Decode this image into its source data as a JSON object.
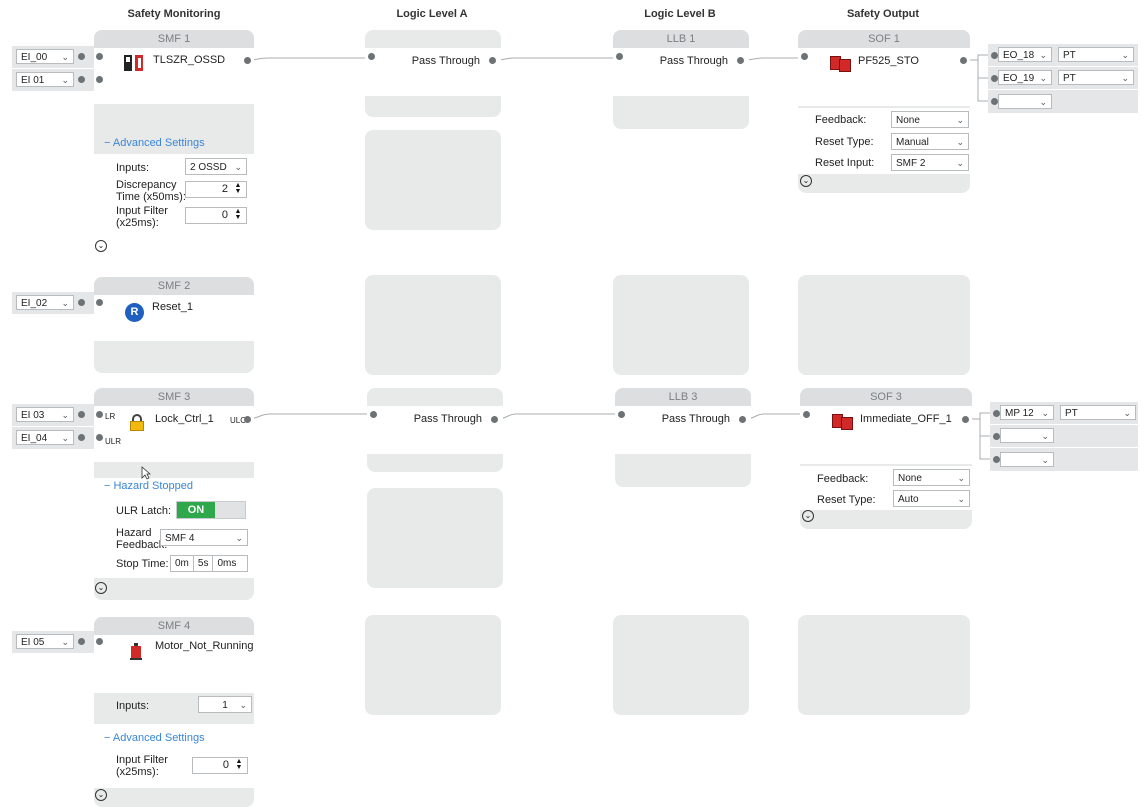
{
  "columns": {
    "safety_monitoring": "Safety Monitoring",
    "logic_level_a": "Logic Level A",
    "logic_level_b": "Logic Level B",
    "safety_output": "Safety Output"
  },
  "inputs": {
    "ei00": "EI_00",
    "ei01": "EI 01",
    "ei02": "EI_02",
    "ei03": "EI 03",
    "ei04": "EI_04",
    "ei05": "EI 05"
  },
  "smf1": {
    "header": "SMF 1",
    "title": "TLSZR_OSSD",
    "advanced": "Advanced Settings",
    "inputs_label": "Inputs:",
    "inputs_value": "2 OSSD",
    "discrepancy_label_1": "Discrepancy",
    "discrepancy_label_2": "Time (x50ms):",
    "discrepancy_value": "2",
    "filter_label_1": "Input Filter",
    "filter_label_2": "(x25ms):",
    "filter_value": "0"
  },
  "smf2": {
    "header": "SMF 2",
    "title": "Reset_1"
  },
  "smf3": {
    "header": "SMF 3",
    "title": "Lock_Ctrl_1",
    "port_lr": "LR",
    "port_ulr": "ULR",
    "port_ulc": "ULC",
    "hazard": "Hazard Stopped",
    "latch_label": "ULR Latch:",
    "latch_value": "ON",
    "feedback_label_1": "Hazard",
    "feedback_label_2": "Feedback:",
    "feedback_value": "SMF 4",
    "stop_label": "Stop Time:",
    "stop_m": "0m",
    "stop_s": "5s",
    "stop_ms": "0ms"
  },
  "smf4": {
    "header": "SMF 4",
    "title": "Motor_Not_Running",
    "inputs_label": "Inputs:",
    "inputs_value": "1",
    "advanced": "Advanced Settings",
    "filter_label_1": "Input Filter",
    "filter_label_2": "(x25ms):",
    "filter_value": "0"
  },
  "lla": {
    "row1": "Pass Through",
    "row3": "Pass Through"
  },
  "llb": {
    "header1": "LLB 1",
    "row1": "Pass Through",
    "header3": "LLB 3",
    "row3": "Pass Through"
  },
  "sof1": {
    "header": "SOF 1",
    "title": "PF525_STO",
    "feedback_label": "Feedback:",
    "feedback_value": "None",
    "reset_type_label": "Reset Type:",
    "reset_type_value": "Manual",
    "reset_input_label": "Reset Input:",
    "reset_input_value": "SMF 2"
  },
  "sof3": {
    "header": "SOF 3",
    "title": "Immediate_OFF_1",
    "feedback_label": "Feedback:",
    "feedback_value": "None",
    "reset_type_label": "Reset Type:",
    "reset_type_value": "Auto"
  },
  "outputs": {
    "eo18": "EO_18",
    "eo18_mode": "PT",
    "eo19": "EO_19",
    "eo19_mode": "PT",
    "mp12": "MP 12",
    "mp12_mode": "PT"
  },
  "colors": {
    "accent_link": "#3a86d6",
    "toggle_on": "#2ea84a",
    "icon_red": "#d12828",
    "reset_blue": "#1f5fbf",
    "lock_yellow": "#f2b90f"
  }
}
